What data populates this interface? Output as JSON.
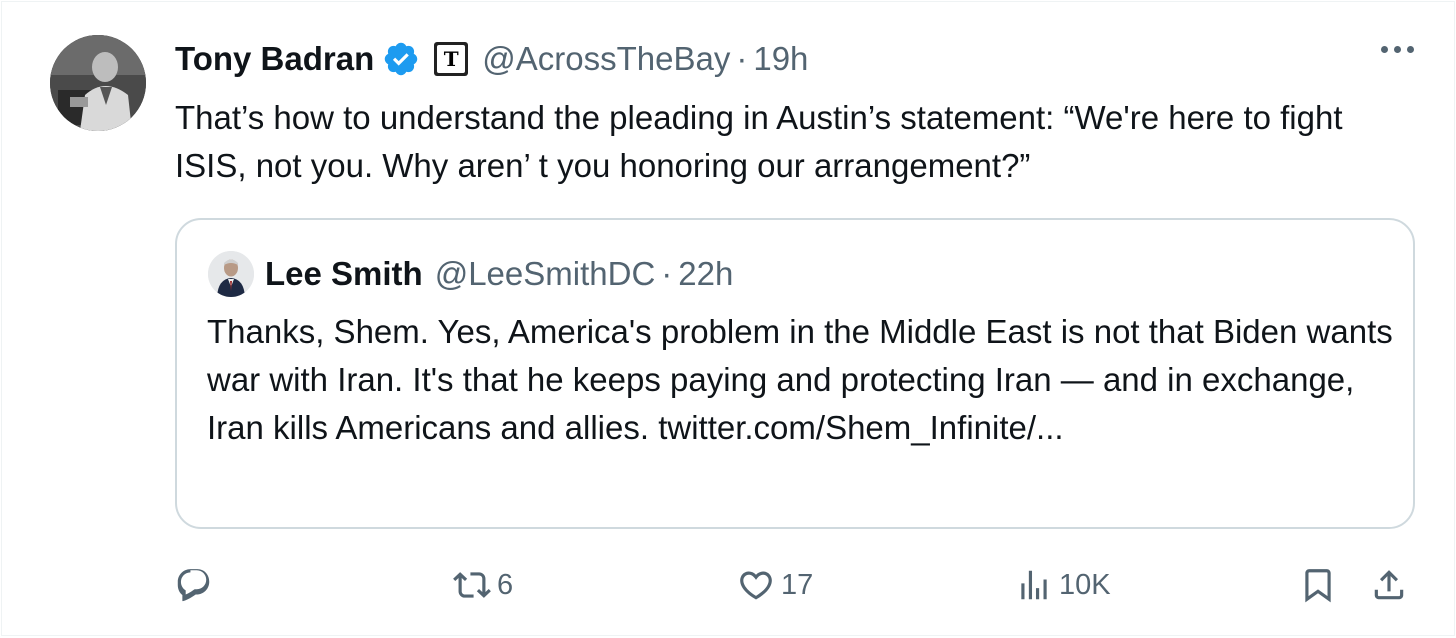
{
  "author": {
    "name": "Tony Badran",
    "handle": "@AcrossTheBay",
    "time": "19h",
    "badge_letter": "T"
  },
  "tweet_text": "That’s how to understand the pleading in Austin’s statement: “We're here to fight ISIS, not you. Why aren’ t you honoring our arrangement?”",
  "quoted": {
    "name": "Lee Smith",
    "handle": "@LeeSmithDC",
    "time": "22h",
    "text": "Thanks, Shem. Yes, America's problem in the Middle East is not that Biden wants war with Iran. It's that he keeps paying and protecting Iran — and in exchange, Iran kills Americans and allies.",
    "link": "twitter.com/Shem_Infinite/..."
  },
  "actions": {
    "reply": "",
    "retweets": "6",
    "likes": "17",
    "views": "10K"
  },
  "separator": "·",
  "colors": {
    "verified": "#1d9bf0",
    "secondary_text": "#536471",
    "border": "#cfd9de"
  }
}
